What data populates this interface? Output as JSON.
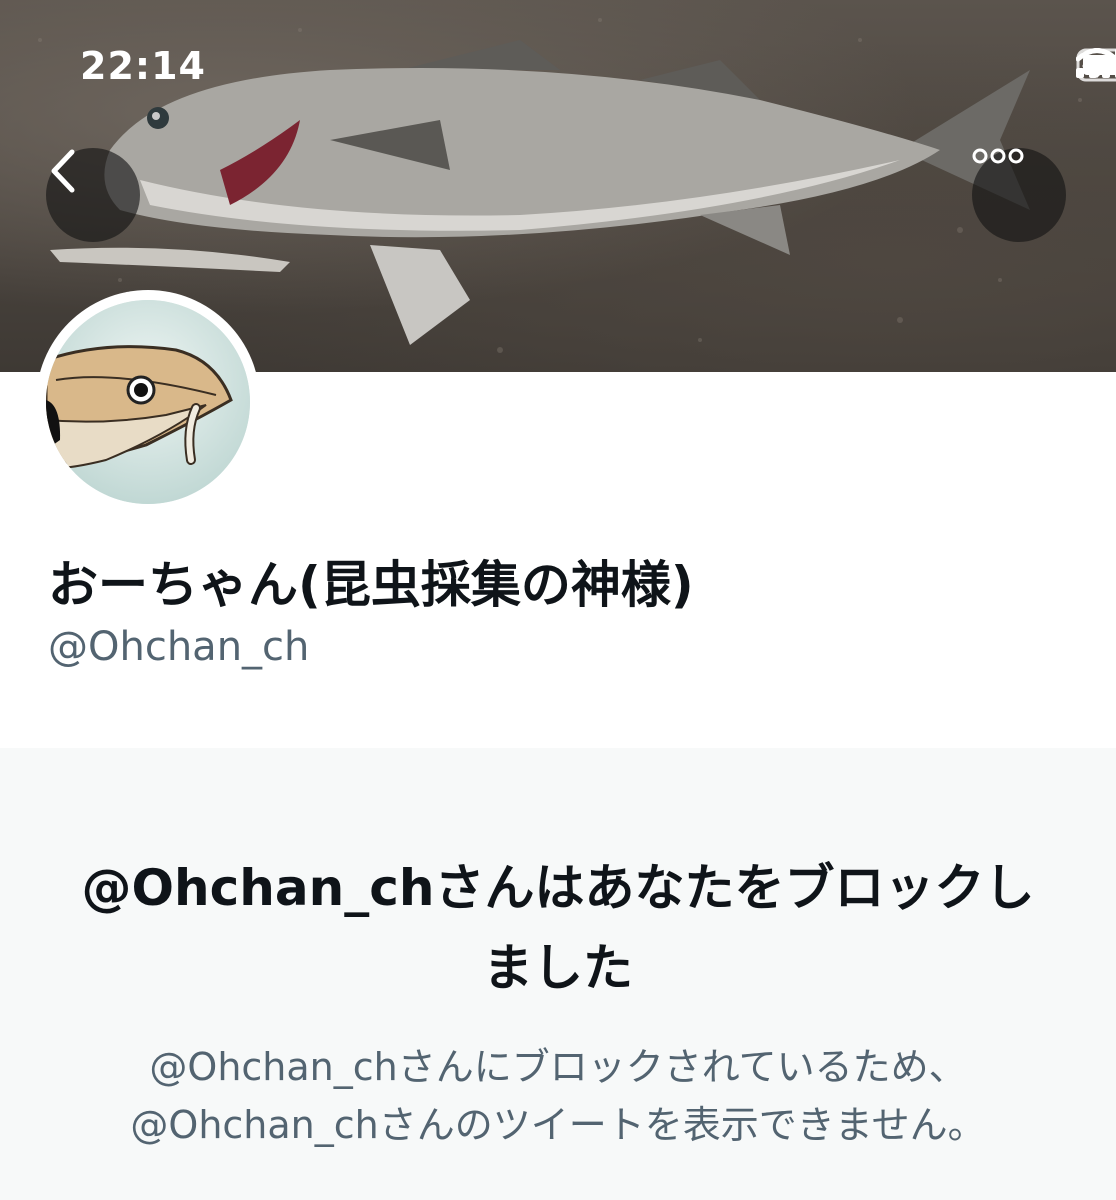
{
  "status_bar": {
    "time": "22:14",
    "icons": [
      "signal-icon",
      "wifi-icon",
      "battery-icon"
    ]
  },
  "header": {
    "back_icon": "chevron-left-icon",
    "more_icon": "more-horizontal-icon",
    "banner_subject": "fish photo"
  },
  "profile": {
    "display_name": "おーちゃん(昆虫採集の神様)",
    "handle": "@Ohchan_ch"
  },
  "blocked": {
    "title": "@Ohchan_chさんはあなたをブロックしました",
    "message": "@Ohchan_chさんにブロックされているため、@Ohchan_chさんのツイートを表示できません。"
  },
  "colors": {
    "text_primary": "#0f1419",
    "text_secondary": "#536471",
    "panel_bg": "#f7f9f9",
    "overlay_button": "#141414"
  }
}
